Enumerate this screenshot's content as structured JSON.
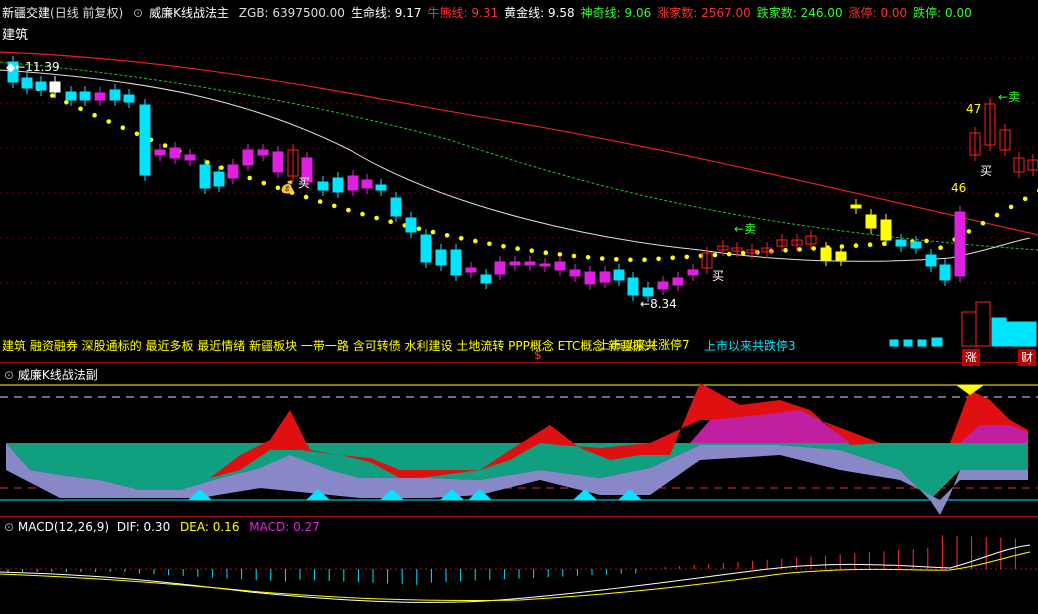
{
  "main": {
    "stock_name": "新疆交建",
    "period": "(日线 前复权)",
    "indicator_name": "威廉K线战法主",
    "stats": [
      {
        "label": "ZGB:",
        "value": "6397500.00",
        "color": "#dddddd"
      },
      {
        "label": "生命线:",
        "value": "9.17",
        "color": "#ffffff"
      },
      {
        "label": "牛熊线:",
        "value": "9.31",
        "color": "#ff3030"
      },
      {
        "label": "黄金线:",
        "value": "9.58",
        "color": "#ffffff"
      },
      {
        "label": "神奇线:",
        "value": "9.06",
        "color": "#30ff30"
      },
      {
        "label": "涨家数:",
        "value": "2567.00",
        "color": "#ff3030"
      },
      {
        "label": "跌家数:",
        "value": "246.00",
        "color": "#30ff30"
      },
      {
        "label": "涨停:",
        "value": "0.00",
        "color": "#ff3030"
      },
      {
        "label": "跌停:",
        "value": "0.00",
        "color": "#30ff30"
      }
    ],
    "industry_top": "建筑",
    "annotations": {
      "high_label": "11.39",
      "low_label": "8.34",
      "buy1": "买",
      "buy2": "买",
      "buy3": "买",
      "sell1": "卖",
      "sell2": "卖",
      "num47": "47",
      "num46": "46"
    },
    "concepts": "建筑 融资融券 深股通标的 最近多板 最近情绪 新疆板块 一带一路 含可转债 水利建设 土地流转 PPP概念 ETC概念 新疆振兴",
    "concept_overlay": "上市以来共涨停7",
    "limit_down_text": "上市以来共跌停3",
    "dollar": "$",
    "zhang": "涨",
    "cai": "财"
  },
  "sub": {
    "title": "威廉K线战法副"
  },
  "macd": {
    "title": "MACD(12,26,9)",
    "dif_label": "DIF:",
    "dif_value": "0.30",
    "dea_label": "DEA:",
    "dea_value": "0.16",
    "macd_label": "MACD:",
    "macd_value": "0.27"
  },
  "colors": {
    "up": "#ff2020",
    "down": "#00e5ff",
    "magenta": "#e020e0",
    "yellow": "#ffff00",
    "green": "#00b080"
  }
}
